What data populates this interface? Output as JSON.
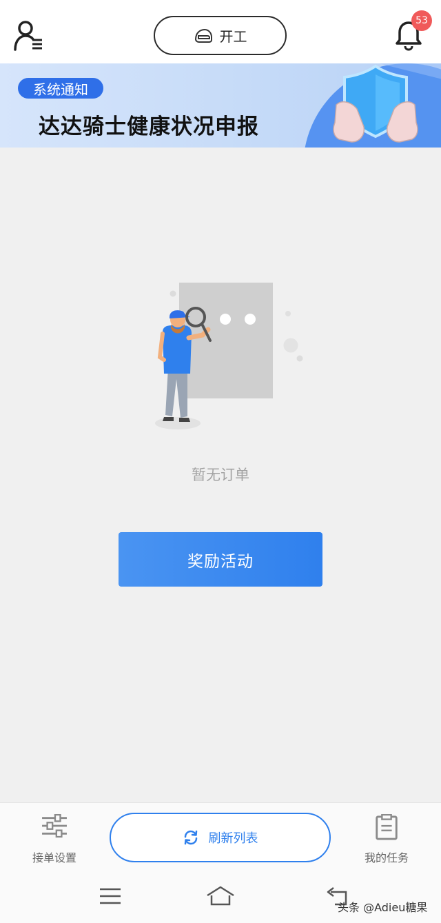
{
  "header": {
    "start_button_label": "开工",
    "notification_count": "53"
  },
  "notice": {
    "tag": "系统通知",
    "title": "达达骑士健康状况申报"
  },
  "main": {
    "empty_text": "暂无订单",
    "reward_button_label": "奖励活动"
  },
  "bottom_bar": {
    "settings_label": "接单设置",
    "refresh_label": "刷新列表",
    "tasks_label": "我的任务"
  },
  "watermark": "头条 @Adieu糖果",
  "colors": {
    "accent": "#2f80ed",
    "badge": "#f05a5a",
    "notice_tag": "#2f6fe8"
  },
  "icons": [
    "user-menu-icon",
    "helmet-icon",
    "bell-icon",
    "sliders-icon",
    "refresh-icon",
    "clipboard-icon",
    "menu-icon",
    "home-icon",
    "back-icon"
  ]
}
